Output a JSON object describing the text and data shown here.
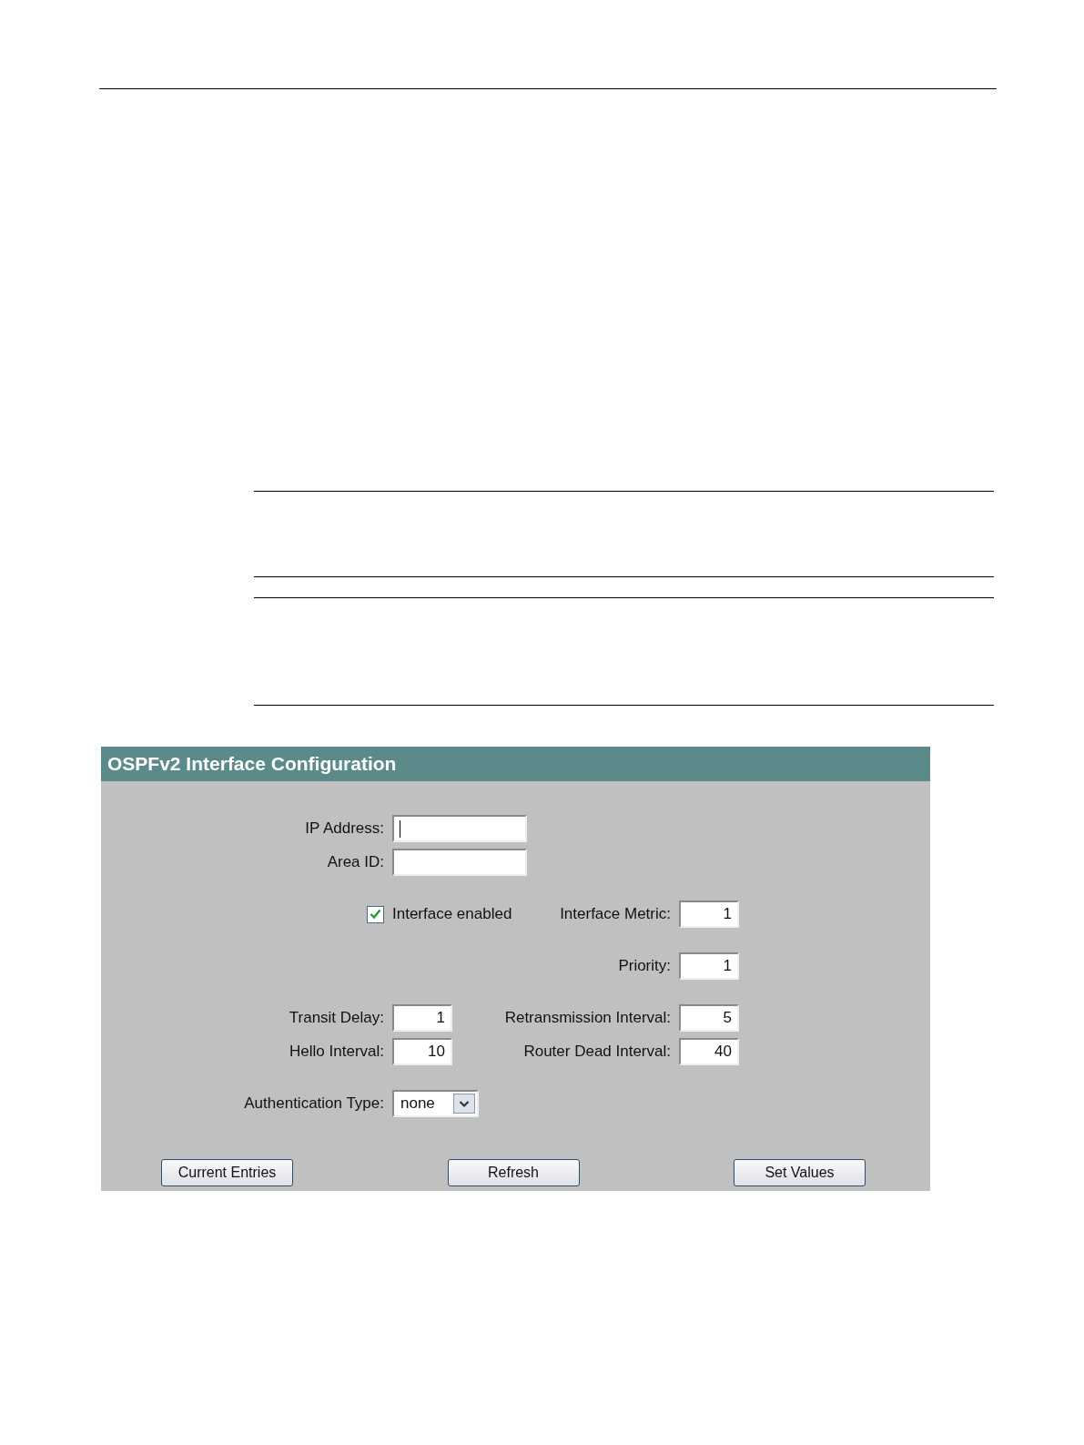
{
  "panel": {
    "title": "OSPFv2 Interface Configuration",
    "groups": [
      [
        {
          "left": {
            "kind": "text",
            "label": "IP Address:",
            "focused": true
          }
        },
        {
          "left": {
            "kind": "text",
            "label": "Area ID:",
            "focused": false
          }
        }
      ],
      [
        {
          "left": {
            "kind": "checkbox",
            "label": "Interface enabled",
            "checked": true
          },
          "right": {
            "kind": "number",
            "label": "Interface Metric:",
            "value": "1",
            "focused": false
          }
        }
      ],
      [
        {
          "right": {
            "kind": "number",
            "label": "Priority:",
            "value": "1",
            "focused": false
          }
        }
      ],
      [
        {
          "left": {
            "kind": "number",
            "label": "Transit Delay:",
            "value": "1",
            "focused": false
          },
          "right": {
            "kind": "number",
            "label": "Retransmission Interval:",
            "value": "5",
            "focused": false
          }
        },
        {
          "left": {
            "kind": "number",
            "label": "Hello Interval:",
            "value": "10",
            "focused": false
          },
          "right": {
            "kind": "number",
            "label": "Router Dead Interval:",
            "value": "40",
            "focused": false
          }
        }
      ],
      [
        {
          "left": {
            "kind": "select",
            "label": "Authentication Type:",
            "value": "none"
          }
        }
      ]
    ],
    "buttons": [
      "Current Entries",
      "Refresh",
      "Set Values"
    ]
  }
}
